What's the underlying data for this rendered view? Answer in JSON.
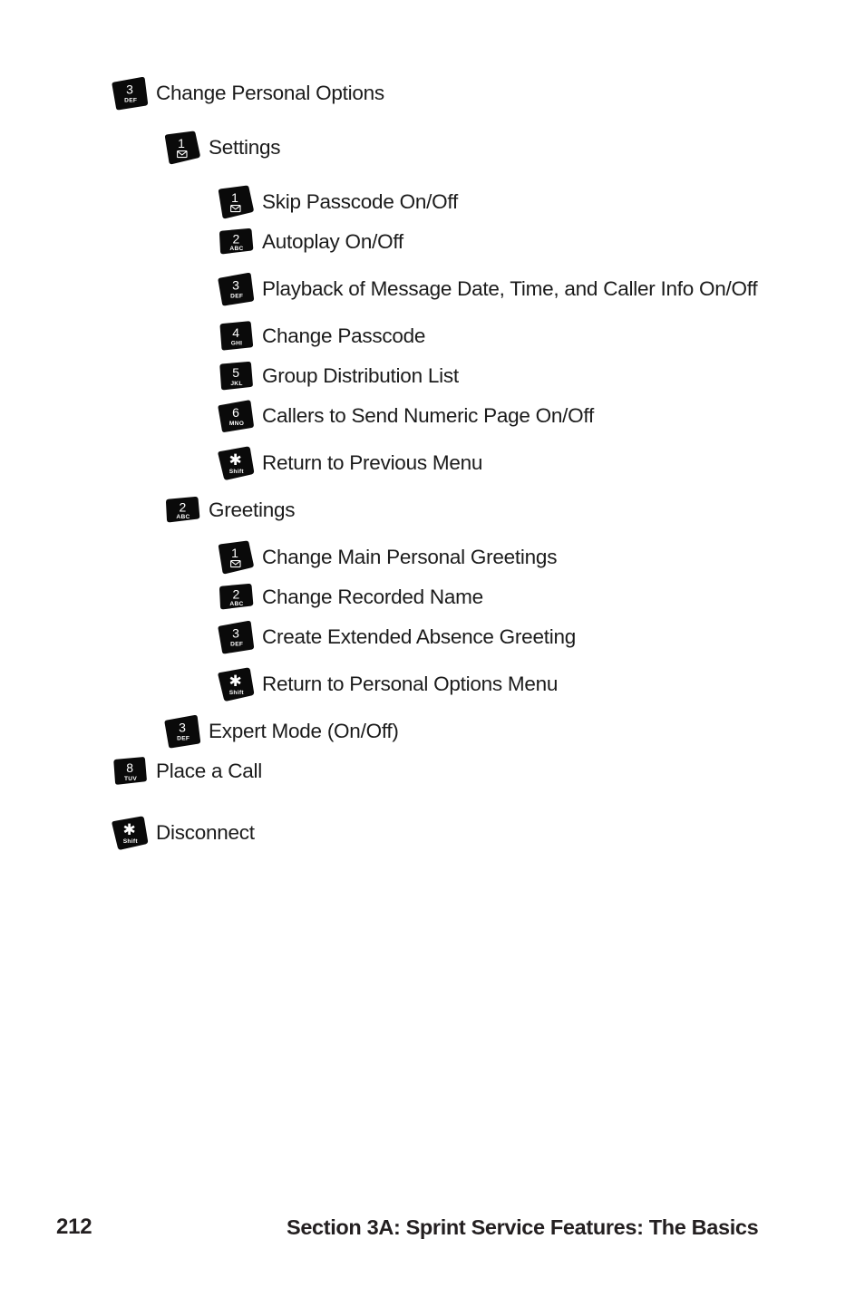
{
  "page": {
    "background_color": "#ffffff",
    "text_color": "#1b1b1b"
  },
  "menu": {
    "items": [
      {
        "key": {
          "digit": "3",
          "sub": "DEF",
          "glyph": "digit"
        },
        "label": "Change Personal Options",
        "level": 0
      },
      {
        "key": {
          "digit": "1",
          "sub": "",
          "glyph": "envelope"
        },
        "label": "Settings",
        "level": 1
      },
      {
        "key": {
          "digit": "1",
          "sub": "",
          "glyph": "envelope"
        },
        "label": "Skip Passcode On/Off",
        "level": 2
      },
      {
        "key": {
          "digit": "2",
          "sub": "ABC",
          "glyph": "digit"
        },
        "label": "Autoplay On/Off",
        "level": 2
      },
      {
        "key": {
          "digit": "3",
          "sub": "DEF",
          "glyph": "digit"
        },
        "label": "Playback of Message Date, Time, and Caller Info On/Off",
        "level": 2
      },
      {
        "key": {
          "digit": "4",
          "sub": "GHI",
          "glyph": "digit"
        },
        "label": "Change Passcode",
        "level": 2
      },
      {
        "key": {
          "digit": "5",
          "sub": "JKL",
          "glyph": "digit"
        },
        "label": "Group Distribution List",
        "level": 2
      },
      {
        "key": {
          "digit": "6",
          "sub": "MNO",
          "glyph": "digit"
        },
        "label": "Callers to Send Numeric Page On/Off",
        "level": 2
      },
      {
        "key": {
          "digit": "*",
          "sub": "Shift",
          "glyph": "star"
        },
        "label": "Return to Previous Menu",
        "level": 2
      },
      {
        "key": {
          "digit": "2",
          "sub": "ABC",
          "glyph": "digit"
        },
        "label": "Greetings",
        "level": 1
      },
      {
        "key": {
          "digit": "1",
          "sub": "",
          "glyph": "envelope"
        },
        "label": "Change Main Personal Greetings",
        "level": 2
      },
      {
        "key": {
          "digit": "2",
          "sub": "ABC",
          "glyph": "digit"
        },
        "label": "Change Recorded Name",
        "level": 2
      },
      {
        "key": {
          "digit": "3",
          "sub": "DEF",
          "glyph": "digit"
        },
        "label": "Create Extended Absence Greeting",
        "level": 2
      },
      {
        "key": {
          "digit": "*",
          "sub": "Shift",
          "glyph": "star"
        },
        "label": "Return to Personal Options Menu",
        "level": 2
      },
      {
        "key": {
          "digit": "3",
          "sub": "DEF",
          "glyph": "digit"
        },
        "label": "Expert Mode (On/Off)",
        "level": 1
      },
      {
        "key": {
          "digit": "8",
          "sub": "TUV",
          "glyph": "digit"
        },
        "label": "Place a Call",
        "level": 0
      },
      {
        "key": {
          "digit": "*",
          "sub": "Shift",
          "glyph": "star"
        },
        "label": "Disconnect",
        "level": 0
      }
    ]
  },
  "footer": {
    "page_number": "212",
    "section_title": "Section 3A: Sprint Service Features: The Basics"
  }
}
